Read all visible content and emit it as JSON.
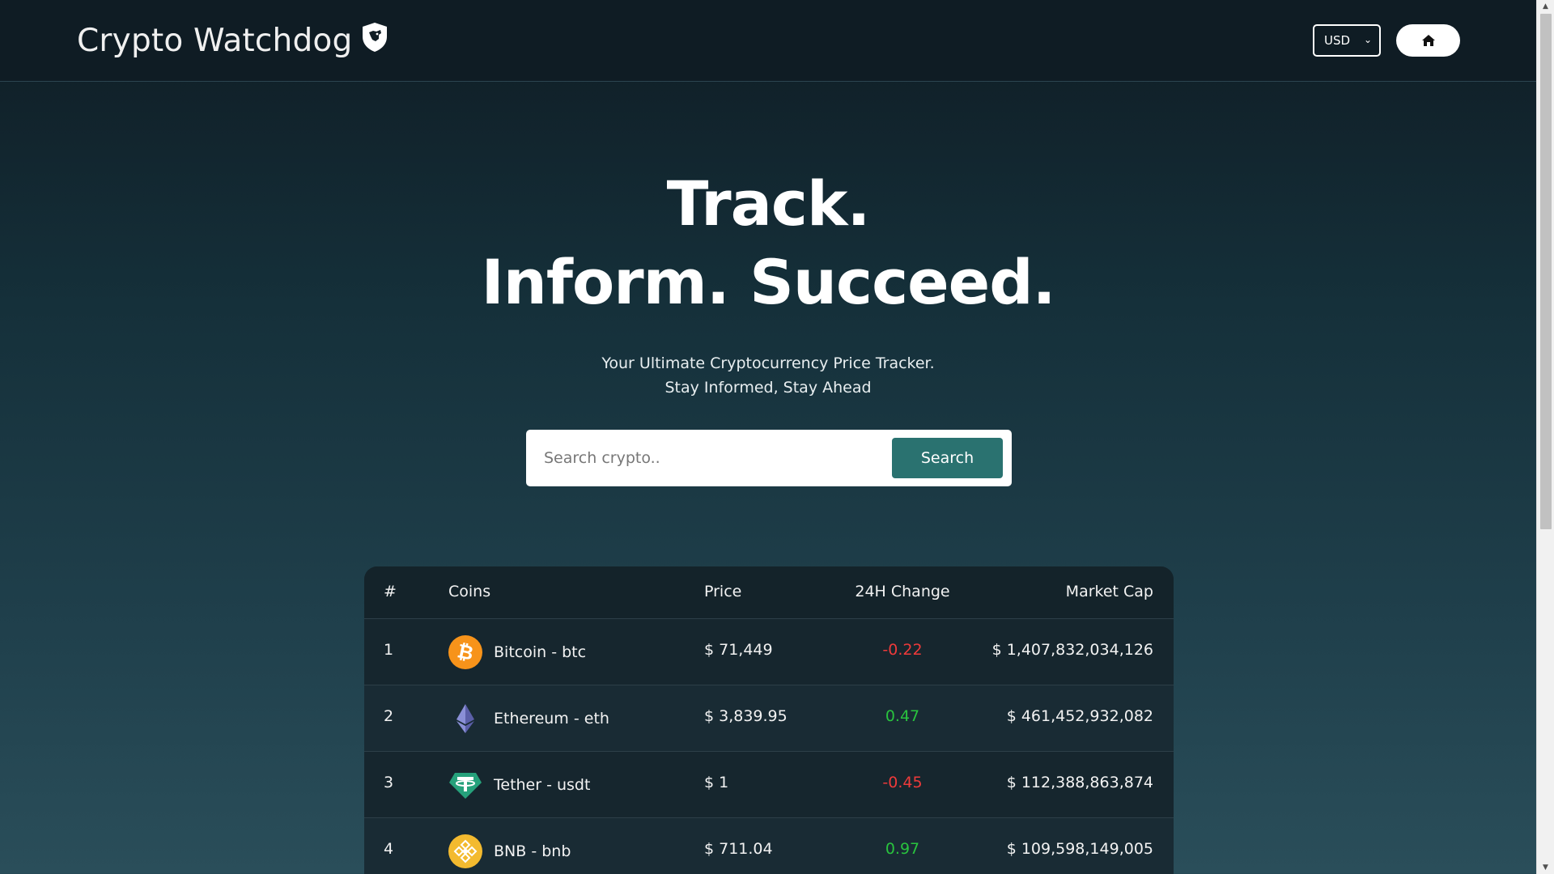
{
  "nav": {
    "brand": "Crypto Watchdog",
    "currency": "USD"
  },
  "hero": {
    "line1": "Track.",
    "line2": "Inform. Succeed.",
    "sub1": "Your Ultimate Cryptocurrency Price Tracker.",
    "sub2": "Stay Informed, Stay Ahead"
  },
  "search": {
    "placeholder": "Search crypto..",
    "button": "Search"
  },
  "table": {
    "headers": {
      "num": "#",
      "coins": "Coins",
      "price": "Price",
      "change": "24H Change",
      "mcap": "Market Cap"
    },
    "rows": [
      {
        "rank": "1",
        "coin": "Bitcoin - btc",
        "price": "$ 71,449",
        "change": "-0.22",
        "mcap": "$ 1,407,832,034,126",
        "logo": "bitcoin-logo-icon"
      },
      {
        "rank": "2",
        "coin": "Ethereum - eth",
        "price": "$ 3,839.95",
        "change": "0.47",
        "mcap": "$ 461,452,932,082",
        "logo": "ethereum-logo-icon"
      },
      {
        "rank": "3",
        "coin": "Tether - usdt",
        "price": "$ 1",
        "change": "-0.45",
        "mcap": "$ 112,388,863,874",
        "logo": "tether-logo-icon"
      },
      {
        "rank": "4",
        "coin": "BNB - bnb",
        "price": "$ 711.04",
        "change": "0.97",
        "mcap": "$ 109,598,149,005",
        "logo": "bnb-logo-icon"
      }
    ]
  },
  "colors": {
    "accent": "#2a7270",
    "negative": "#ee3a3a",
    "positive": "#29c33e"
  }
}
